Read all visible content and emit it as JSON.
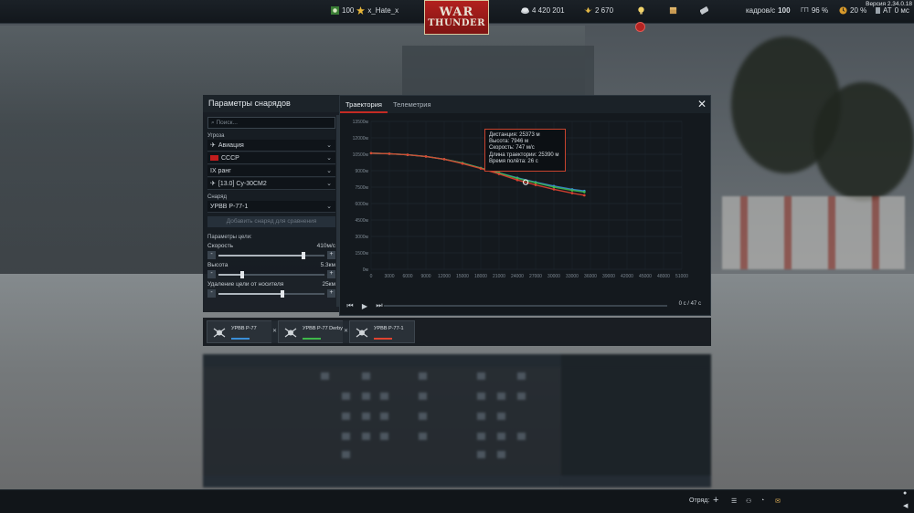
{
  "topbar": {
    "rank_value": "100",
    "username": "x_Hate_x",
    "silver": "4 420 201",
    "gold": "2 670",
    "fps_label": "кадров/с",
    "fps_value": "100",
    "cpu_value": "96 %",
    "cpu_prefix": "ГП",
    "battery_value": "20 %",
    "ping_label": "AT",
    "ping_value": "0 мс",
    "version": "Версия 2.34.0.18"
  },
  "logo": {
    "line1": "WAR",
    "line2": "THUNDER"
  },
  "left_panel": {
    "title": "Параметры снарядов",
    "search_placeholder": "Поиск...",
    "threat_label": "Угроза",
    "threat_value": "Авиация",
    "country_value": "СССР",
    "rank_value": "IX ранг",
    "vehicle_value": "[13.0] Су-30СМ2",
    "shell_label": "Снаряд",
    "shell_value": "УРВВ Р-77-1",
    "add_button": "Добавить снаряд для сравнения",
    "target_params": "Параметры цели:",
    "speed_label": "Скорость",
    "speed_value": "410м/с",
    "speed_fraction": 0.8,
    "altitude_label": "Высота",
    "altitude_value": "5.3км",
    "altitude_fraction": 0.22,
    "distance_label": "Удаление цели от носителя",
    "distance_value": "25км",
    "distance_fraction": 0.6
  },
  "chart_panel": {
    "tab_trajectory": "Траектория",
    "tab_telemetry": "Телеметрия",
    "time_readout": "0 с  /  47 с"
  },
  "tooltip": {
    "distance": "Дистанция: 25373 м",
    "altitude": "Высота: 7946 м",
    "speed": "Скорость: 747 м/с",
    "trajectory_length": "Длина траектории: 25390 м",
    "flight_time": "Время полёта: 26 с"
  },
  "chart_data": {
    "type": "line",
    "x_ticks": [
      "0",
      "3000",
      "6000",
      "9000",
      "12000",
      "15000",
      "18000",
      "21000",
      "24000",
      "27000",
      "30000",
      "33000",
      "36000",
      "39000",
      "42000",
      "45000",
      "48000",
      "51000"
    ],
    "y_ticks": [
      "0м",
      "1500м",
      "3000м",
      "4500м",
      "6000м",
      "7500м",
      "9000м",
      "10500м",
      "12000м",
      "13500м"
    ],
    "xlim": [
      0,
      51000
    ],
    "ylim": [
      0,
      13500
    ],
    "grid": true,
    "series": [
      {
        "name": "УРВВ Р-77",
        "color": "#3a8fd8",
        "x": [
          0,
          3000,
          6000,
          9000,
          12000,
          15000,
          18000,
          21000,
          24000,
          27000,
          30000,
          33000,
          35000
        ],
        "y": [
          10600,
          10550,
          10450,
          10300,
          10050,
          9700,
          9250,
          8800,
          8350,
          7950,
          7600,
          7300,
          7150
        ]
      },
      {
        "name": "УРВВ Р-77 Derby",
        "color": "#3fb84a",
        "x": [
          0,
          3000,
          6000,
          9000,
          12000,
          15000,
          18000,
          21000,
          24000,
          27000,
          30000,
          33000,
          35000
        ],
        "y": [
          10600,
          10550,
          10450,
          10300,
          10050,
          9700,
          9250,
          8800,
          8300,
          7900,
          7500,
          7200,
          7050
        ]
      },
      {
        "name": "УРВВ Р-77-1",
        "color": "#e04330",
        "x": [
          0,
          3000,
          6000,
          9000,
          12000,
          15000,
          18000,
          21000,
          24000,
          27000,
          30000,
          33000,
          35000
        ],
        "y": [
          10600,
          10550,
          10450,
          10300,
          10050,
          9650,
          9200,
          8700,
          8150,
          7700,
          7300,
          6950,
          6750
        ]
      }
    ],
    "marker": {
      "x": 25373,
      "y": 7946
    }
  },
  "cards": [
    {
      "name": "УРВВ Р-77",
      "color": "#3a8fd8"
    },
    {
      "name": "УРВВ Р-77 Derby",
      "color": "#3fb84a"
    },
    {
      "name": "УРВВ Р-77-1",
      "color": "#e04330"
    }
  ],
  "bottombar": {
    "squad_label": "Отряд:",
    "squad_plus": "+"
  }
}
